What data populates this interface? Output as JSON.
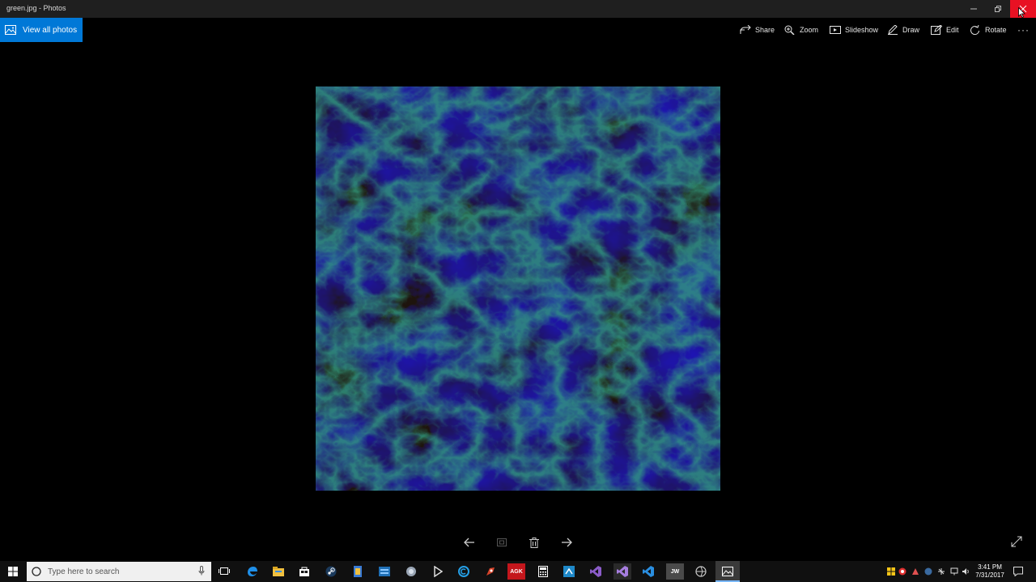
{
  "window": {
    "title": "green.jpg - Photos",
    "controls": {
      "minimize_icon": "minimize-icon",
      "maximize_icon": "restore-icon",
      "close_icon": "close-icon"
    },
    "close_color": "#e81123"
  },
  "appbar": {
    "view_all_label": "View all photos",
    "accent": "#0078d7",
    "tools": [
      {
        "label": "Share",
        "icon": "share-icon"
      },
      {
        "label": "Zoom",
        "icon": "zoom-icon"
      },
      {
        "label": "Slideshow",
        "icon": "slideshow-icon"
      },
      {
        "label": "Draw",
        "icon": "pen-icon"
      },
      {
        "label": "Edit",
        "icon": "edit-icon"
      },
      {
        "label": "Rotate",
        "icon": "rotate-icon"
      }
    ],
    "more_label": "···"
  },
  "image": {
    "subject": "green marble texture",
    "dominant_color": "#0f5a3a"
  },
  "bottom_nav": {
    "icons": [
      "arrow-left-icon",
      "slideshow-icon",
      "trash-icon",
      "arrow-right-icon",
      "fullscreen-icon"
    ]
  },
  "taskbar": {
    "search_placeholder": "Type here to search",
    "apps": [
      "task-view-icon",
      "edge-icon",
      "file-explorer-icon",
      "store-icon",
      "steam-icon",
      "app-icon",
      "app-icon",
      "app-icon",
      "app-icon",
      "app-icon",
      "agk-icon",
      "calculator-icon",
      "app-icon",
      "visual-studio-icon",
      "visual-studio-icon",
      "vscode-icon",
      "jw-icon",
      "app-icon",
      "photos-icon"
    ],
    "agk_label": "AGK",
    "jw_label": "JW",
    "clock_time": "3:41 PM",
    "clock_date": "7/31/2017"
  }
}
